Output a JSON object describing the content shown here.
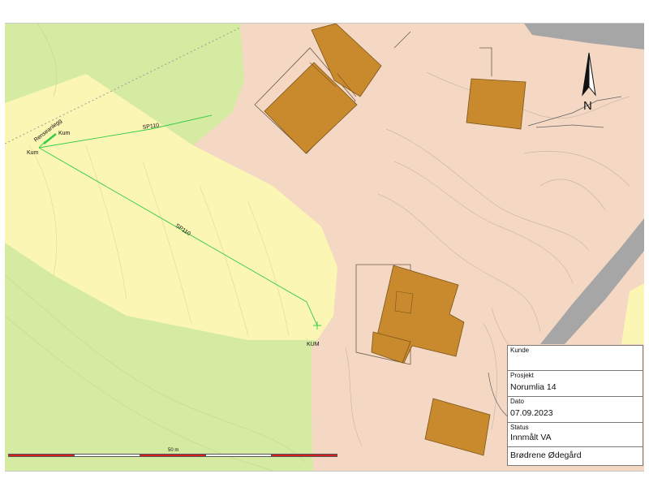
{
  "map": {
    "labels": {
      "kum_left": "Kum",
      "kum_top": "Kum",
      "kum_bottom": "KUM",
      "pipe_upper": "SP110",
      "pipe_lower": "SP110",
      "tank": "Renseanlegg"
    },
    "north_label": "N",
    "colors": {
      "forest": "#d5eba2",
      "cultivated": "#fbf6b3",
      "developed": "#f4d8c4",
      "building": "#c98a2e",
      "road": "#a6a6a6",
      "pipe": "#33cc44"
    }
  },
  "scale": {
    "label": "50 m"
  },
  "title_block": {
    "kunde_label": "Kunde",
    "kunde_value": "",
    "prosjekt_label": "Prosjekt",
    "prosjekt_value": "Norumlia 14",
    "dato_label": "Dato",
    "dato_value": "07.09.2023",
    "status_label": "Status",
    "status_value": "Innmålt VA",
    "company": "Brødrene Ødegård"
  }
}
